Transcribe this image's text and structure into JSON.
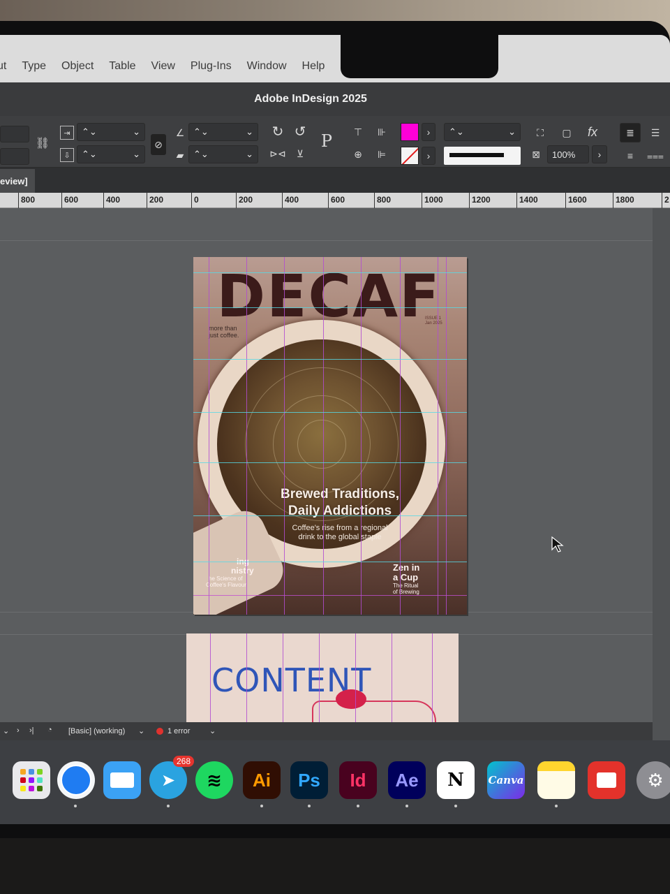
{
  "menu": {
    "items": [
      "ut",
      "Type",
      "Object",
      "Table",
      "View",
      "Plug-Ins",
      "Window",
      "Help"
    ]
  },
  "window": {
    "title": "Adobe InDesign 2025"
  },
  "control_panel": {
    "zoom_value": "100%",
    "fill_color": "#ff00d8"
  },
  "tab": {
    "label": "eview]"
  },
  "ruler": {
    "labels": [
      "800",
      "600",
      "400",
      "200",
      "0",
      "200",
      "400",
      "600",
      "800",
      "1000",
      "1200",
      "1400",
      "1600",
      "1800",
      "2"
    ]
  },
  "cover": {
    "masthead": "DECAF",
    "tagline_line1": "more than",
    "tagline_line2": "just coffee.",
    "issue_line1": "ISSUE 1",
    "issue_line2": "Jan 2025",
    "headline_line1": "Brewed Traditions,",
    "headline_line2": "Daily Addictions",
    "subhead_line1": "Coffee's rise from a regional",
    "subhead_line2": "drink to the global staple",
    "left_feature_line1": "ing",
    "left_feature_line2": "nistry",
    "left_feature_sub1": "he Science of",
    "left_feature_sub2": "Coffee's Flavour",
    "right_feature_line1": "Zen in",
    "right_feature_line2": "a Cup",
    "right_feature_sub1": "The Ritual",
    "right_feature_sub2": "of Brewing"
  },
  "page2": {
    "sketch_text": "CONTENT"
  },
  "status": {
    "style": "[Basic] (working)",
    "errors": "1 error"
  },
  "dock": {
    "telegram_badge": "268",
    "apps": [
      "Launchpad",
      "Safari",
      "Mail",
      "Telegram",
      "Spotify",
      "Ai",
      "Ps",
      "Id",
      "Ae",
      "N",
      "Canva",
      "Notes",
      "Photo Booth",
      "System Settings"
    ]
  }
}
